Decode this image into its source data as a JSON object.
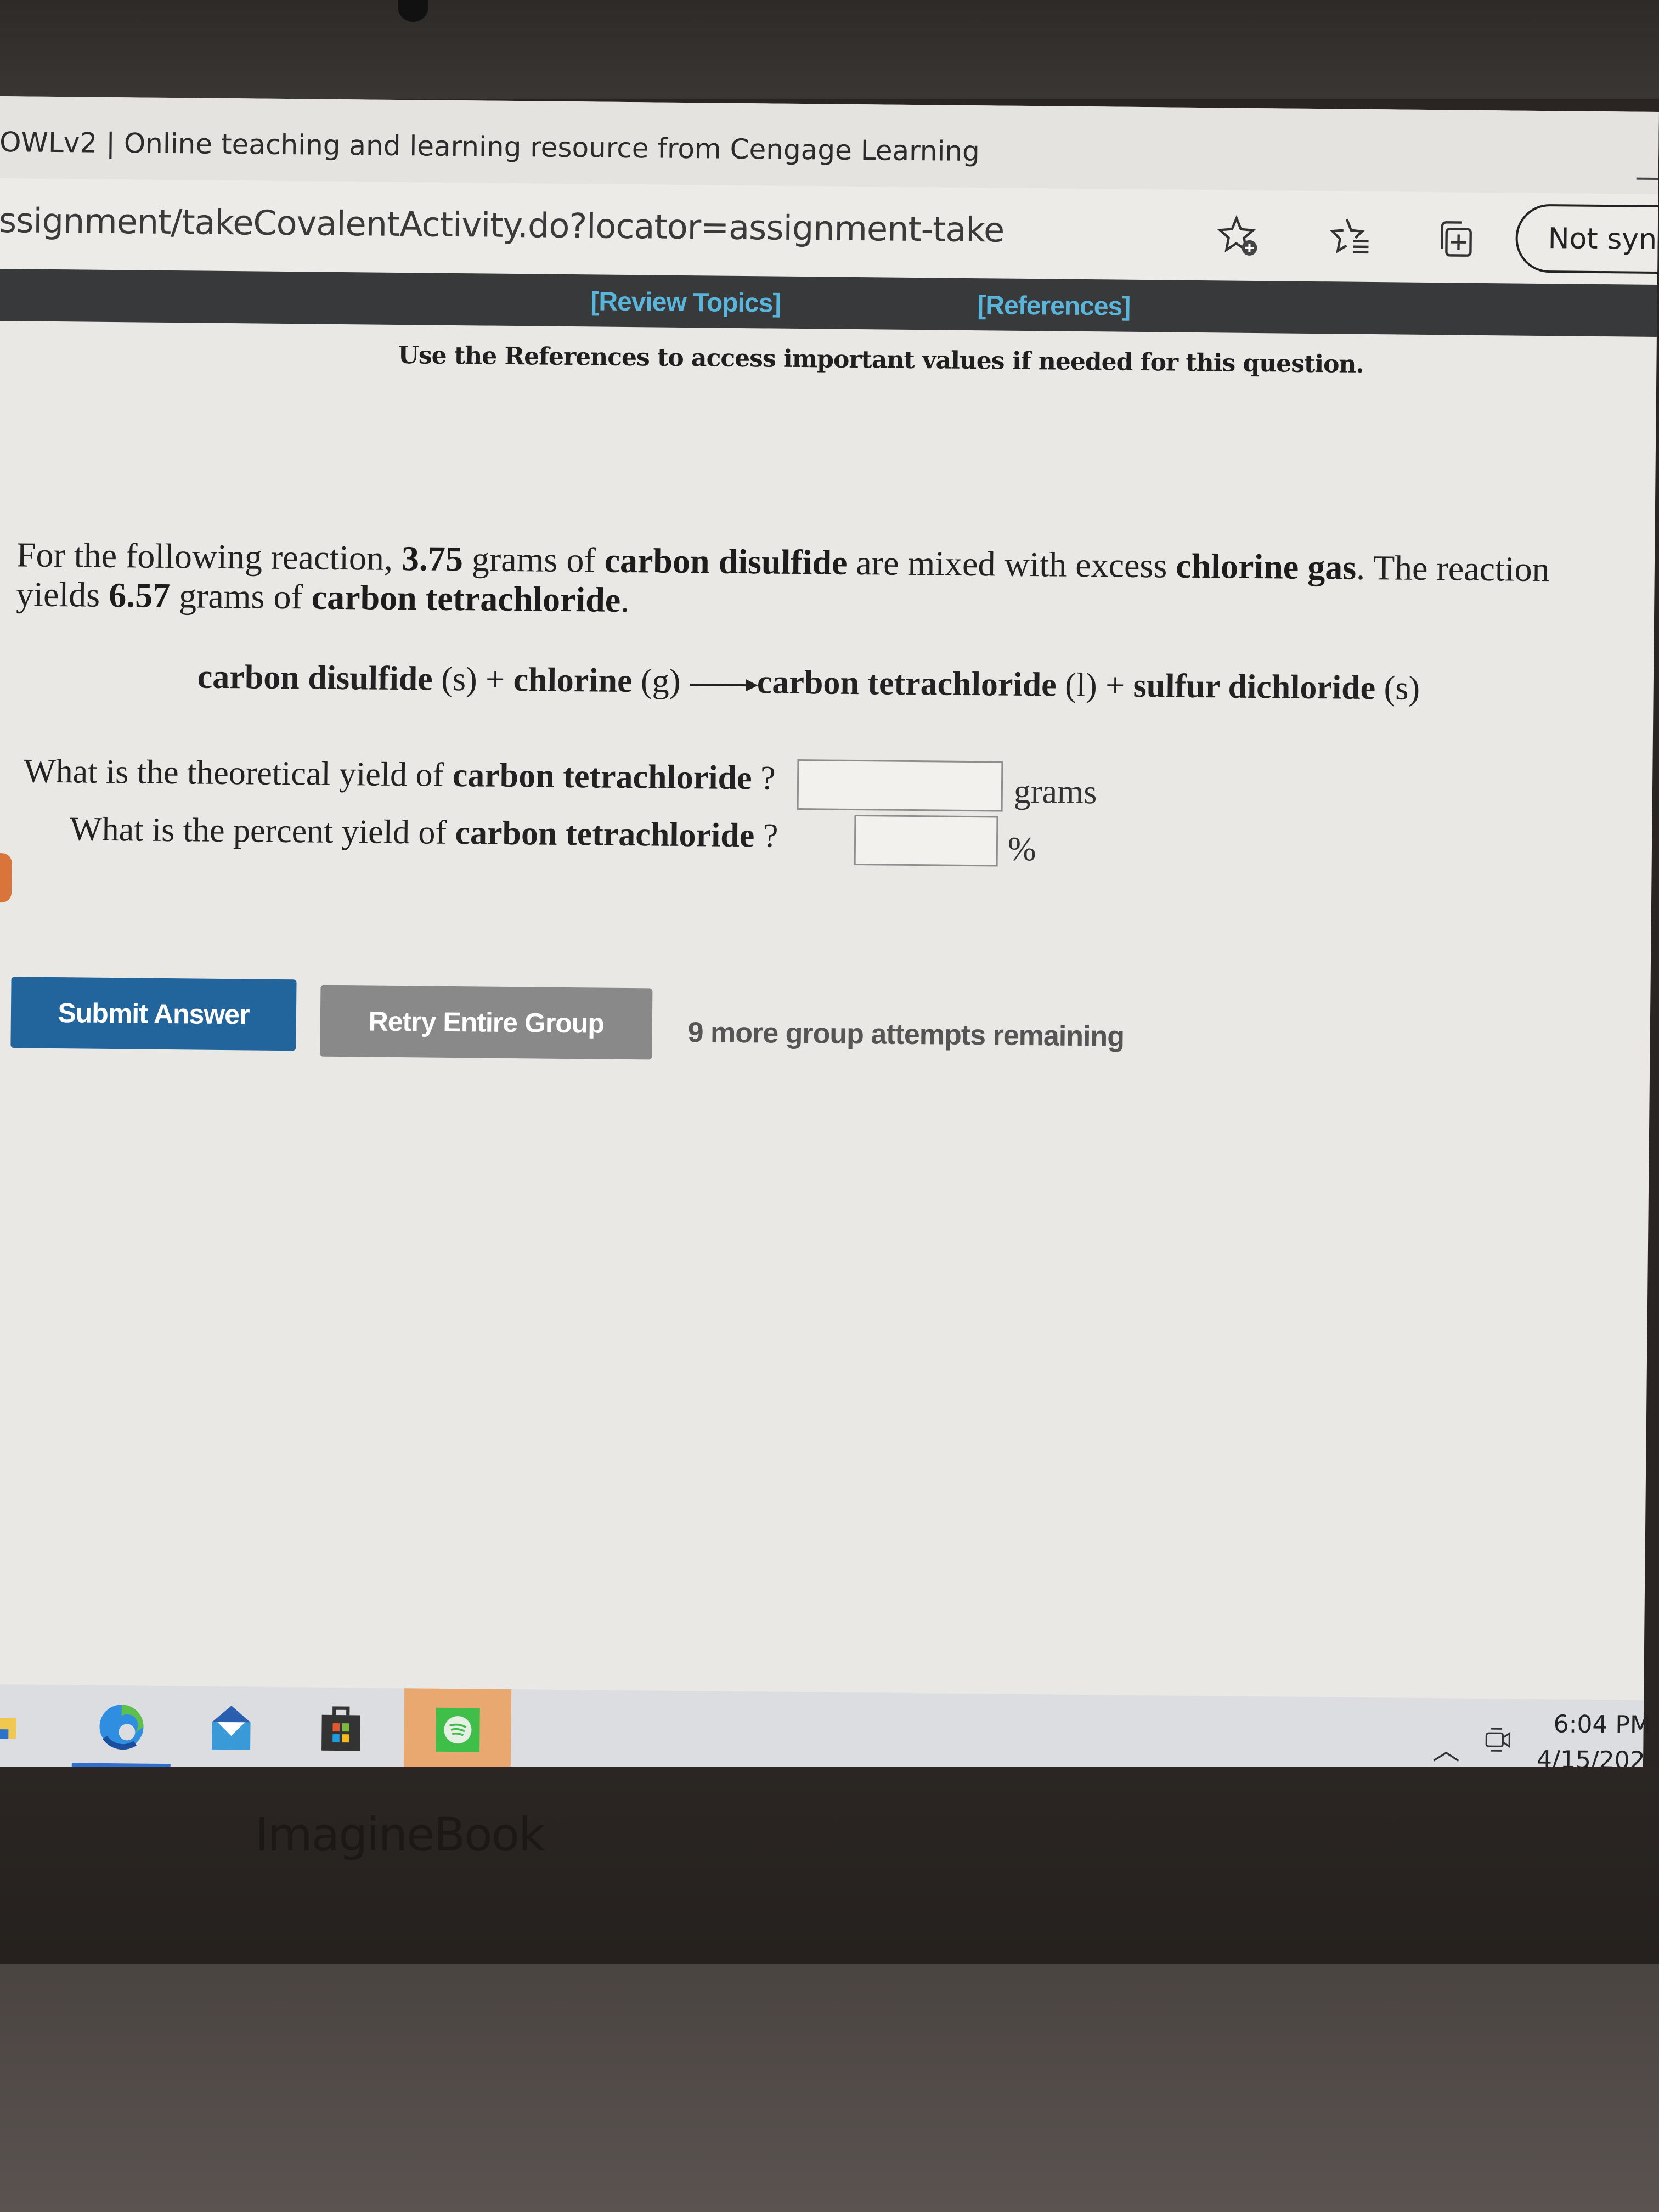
{
  "browser": {
    "tab_title": "OWLv2 | Online teaching and learning resource from Cengage Learning",
    "url": "ssignment/takeCovalentActivity.do?locator=assignment-take",
    "toolbar_icons": [
      "add-favorite-icon",
      "favorites-list-icon",
      "collections-icon"
    ],
    "profile_button": "Not sync"
  },
  "owl_header": {
    "review_topics": "[Review Topics]",
    "references": "[References]",
    "instruction": "Use the References to access important values if needed for this question."
  },
  "question": {
    "intro_1": "For the following reaction, ",
    "mass_reactant": "3.75",
    "intro_2": " grams of ",
    "reactant": "carbon disulfide",
    "intro_3": " are mixed with excess ",
    "excess_reagent": "chlorine gas",
    "intro_4": ". The reaction yields ",
    "mass_product": "6.57",
    "intro_5": " grams of ",
    "product": "carbon tetrachloride",
    "intro_6": ".",
    "equation": {
      "r1": "carbon disulfide",
      "r1_state": "(s)",
      "plus": "+",
      "r2": "chlorine",
      "r2_state": "(g)",
      "p1": "carbon tetrachloride",
      "p1_state": "(l)",
      "p2": "sulfur dichloride",
      "p2_state": "(s)"
    },
    "q1_prefix": "What is the theoretical yield of ",
    "q1_subject": "carbon tetrachloride",
    "q1_suffix": " ?",
    "q1_value": "",
    "q1_unit": "grams",
    "q2_prefix": "What is the percent yield of ",
    "q2_subject": "carbon tetrachloride",
    "q2_suffix": " ?",
    "q2_value": "",
    "q2_unit": "%"
  },
  "actions": {
    "submit": "Submit Answer",
    "retry": "Retry Entire Group",
    "attempts": "9 more group attempts remaining"
  },
  "taskbar": {
    "apps": [
      "file-explorer",
      "edge",
      "mail",
      "microsoft-store",
      "spotify"
    ],
    "time": "6:04 PM",
    "date": "4/15/202"
  },
  "device": {
    "brand": "ImagineBook"
  },
  "colors": {
    "submit_button": "#22649c",
    "retry_button": "#898989",
    "link": "#5bb4d9",
    "owl_bar": "#37393b"
  }
}
